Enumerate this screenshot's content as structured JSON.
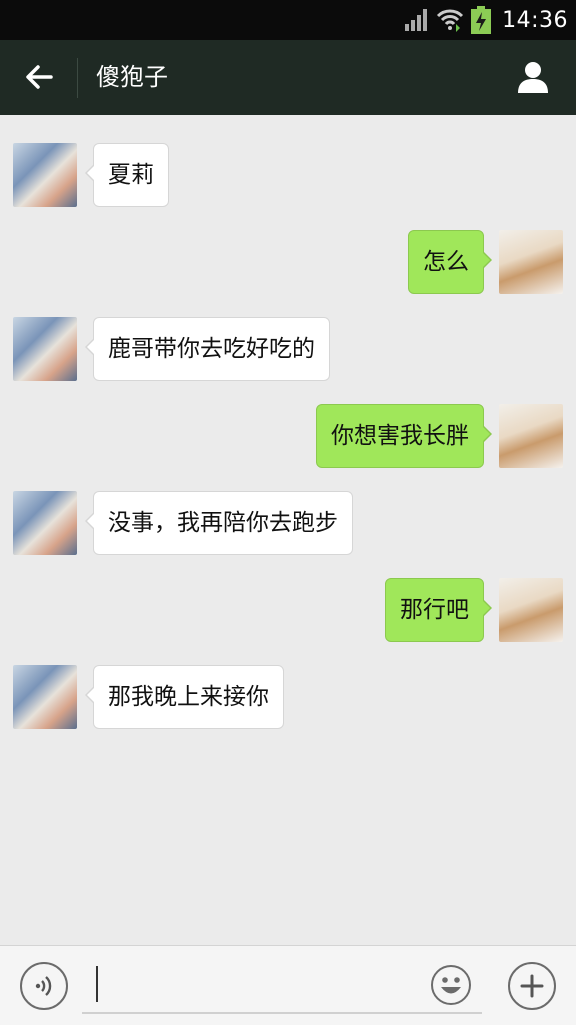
{
  "status_bar": {
    "time": "14:36"
  },
  "header": {
    "title": "傻狍子"
  },
  "messages": [
    {
      "side": "left",
      "text": "夏莉"
    },
    {
      "side": "right",
      "text": "怎么"
    },
    {
      "side": "left",
      "text": "鹿哥带你去吃好吃的"
    },
    {
      "side": "right",
      "text": "你想害我长胖"
    },
    {
      "side": "left",
      "text": "没事，我再陪你去跑步"
    },
    {
      "side": "right",
      "text": "那行吧"
    },
    {
      "side": "left",
      "text": "那我晚上来接你"
    }
  ],
  "composer": {
    "value": ""
  },
  "colors": {
    "accent_bubble": "#a0e75a",
    "title_bar": "#1f2a24"
  }
}
